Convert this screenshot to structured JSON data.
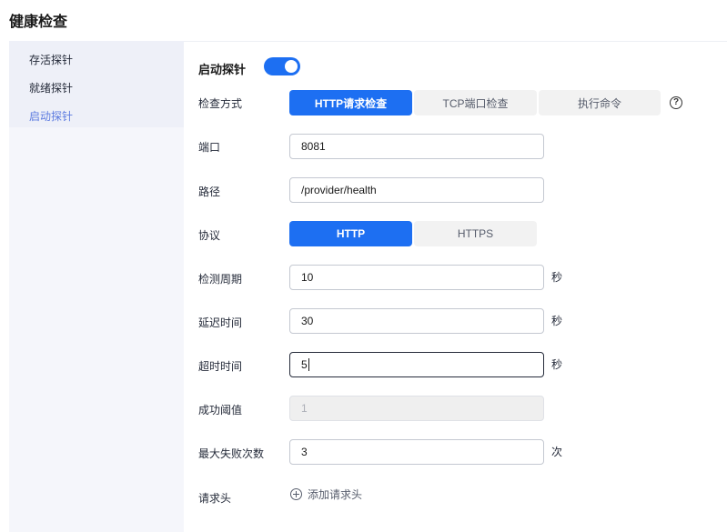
{
  "page": {
    "title": "健康检查"
  },
  "sidebar": {
    "items": [
      {
        "label": "存活探针",
        "active": false
      },
      {
        "label": "就绪探针",
        "active": false
      },
      {
        "label": "启动探针",
        "active": true
      }
    ]
  },
  "probe": {
    "section_title": "启动探针",
    "enabled": true,
    "check_method": {
      "label": "检查方式",
      "options": [
        "HTTP请求检查",
        "TCP端口检查",
        "执行命令"
      ],
      "selected": "HTTP请求检查",
      "help_icon": "question-circle-icon"
    },
    "port": {
      "label": "端口",
      "value": "8081"
    },
    "path": {
      "label": "路径",
      "value": "/provider/health"
    },
    "protocol": {
      "label": "协议",
      "options": [
        "HTTP",
        "HTTPS"
      ],
      "selected": "HTTP"
    },
    "period": {
      "label": "检测周期",
      "value": "10",
      "unit": "秒"
    },
    "delay": {
      "label": "延迟时间",
      "value": "30",
      "unit": "秒"
    },
    "timeout": {
      "label": "超时时间",
      "value": "5",
      "unit": "秒"
    },
    "success_threshold": {
      "label": "成功阈值",
      "value": "1"
    },
    "failure_threshold": {
      "label": "最大失败次数",
      "value": "3",
      "unit": "次"
    },
    "headers": {
      "label": "请求头",
      "add_label": "添加请求头",
      "add_icon": "plus-circle-icon"
    }
  },
  "colors": {
    "accent": "#1d6ff2",
    "sidebar_active": "#5e7ce0",
    "sidebar_bg": "#f5f6fb"
  }
}
